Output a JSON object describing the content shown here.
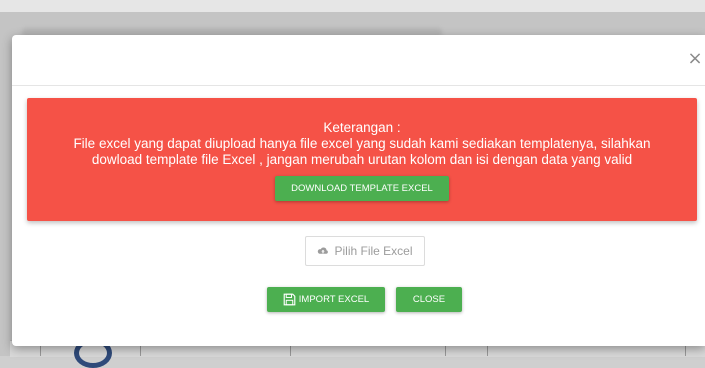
{
  "modal": {
    "close_icon": "times-icon",
    "alert": {
      "title": "Keterangan :",
      "message_line1": "File excel yang dapat diupload hanya file excel yang sudah kami sediakan templatenya, silahkan",
      "message_line2": "dowload template file Excel , jangan merubah urutan kolom dan isi dengan data yang valid",
      "download_button": "DOWNLOAD TEMPLATE EXCEL",
      "color": "#f55247"
    },
    "pick_file": {
      "label": "Pilih File Excel",
      "icon": "cloud-upload-icon"
    },
    "import_button": {
      "label": "IMPORT EXCEL",
      "icon": "save-icon"
    },
    "close_button": {
      "label": "CLOSE"
    },
    "button_color": "#4caf50"
  }
}
